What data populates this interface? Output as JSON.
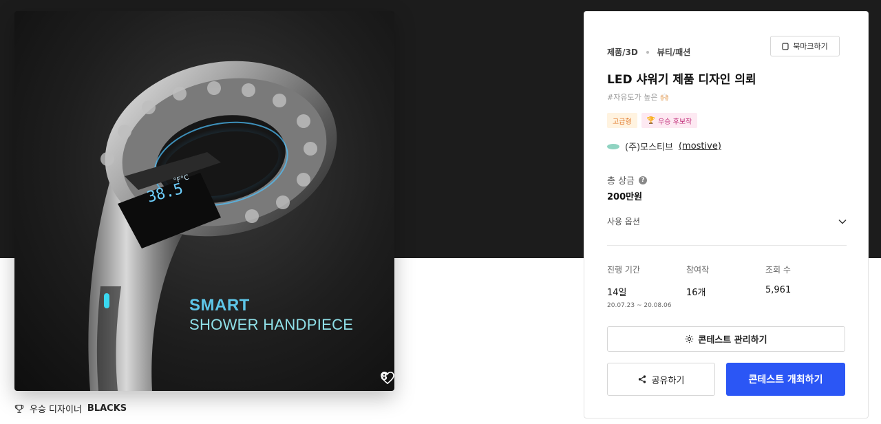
{
  "image": {
    "overlay_line1": "SMART",
    "overlay_line2": "SHOWER HANDPIECE",
    "display_temp": "38.5",
    "display_unit": "°F°C",
    "likes": "8"
  },
  "winner": {
    "label": "우승 디자이너",
    "name": "BLACKS"
  },
  "panel": {
    "category": "제품/3D",
    "subcategory": "뷰티/패션",
    "bookmark_label": "북마크하기",
    "title": "LED 샤워기 제품 디자인 의뢰",
    "hashtag": "#자유도가 높은 🙌🏻",
    "badges": {
      "premium": "고급형",
      "nominee": "우승 후보작"
    },
    "company_name": "(주)모스티브",
    "company_handle": "(mostive)",
    "prize_label": "총 상금",
    "prize_value": "200만원",
    "usage_label": "사용 옵션",
    "stats": {
      "duration_label": "진행 기간",
      "duration_value": "14일",
      "duration_range": "20.07.23 ~ 20.08.06",
      "entries_label": "참여작",
      "entries_value": "16개",
      "views_label": "조회 수",
      "views_value": "5,961"
    },
    "manage_label": "콘테스트 관리하기",
    "share_label": "공유하기",
    "host_label": "콘테스트 개최하기"
  },
  "colors": {
    "primary": "#2b56f5",
    "hero_bg": "#1c1c1c",
    "premium_badge": "#e0782a",
    "nominee_badge": "#c1307a"
  }
}
